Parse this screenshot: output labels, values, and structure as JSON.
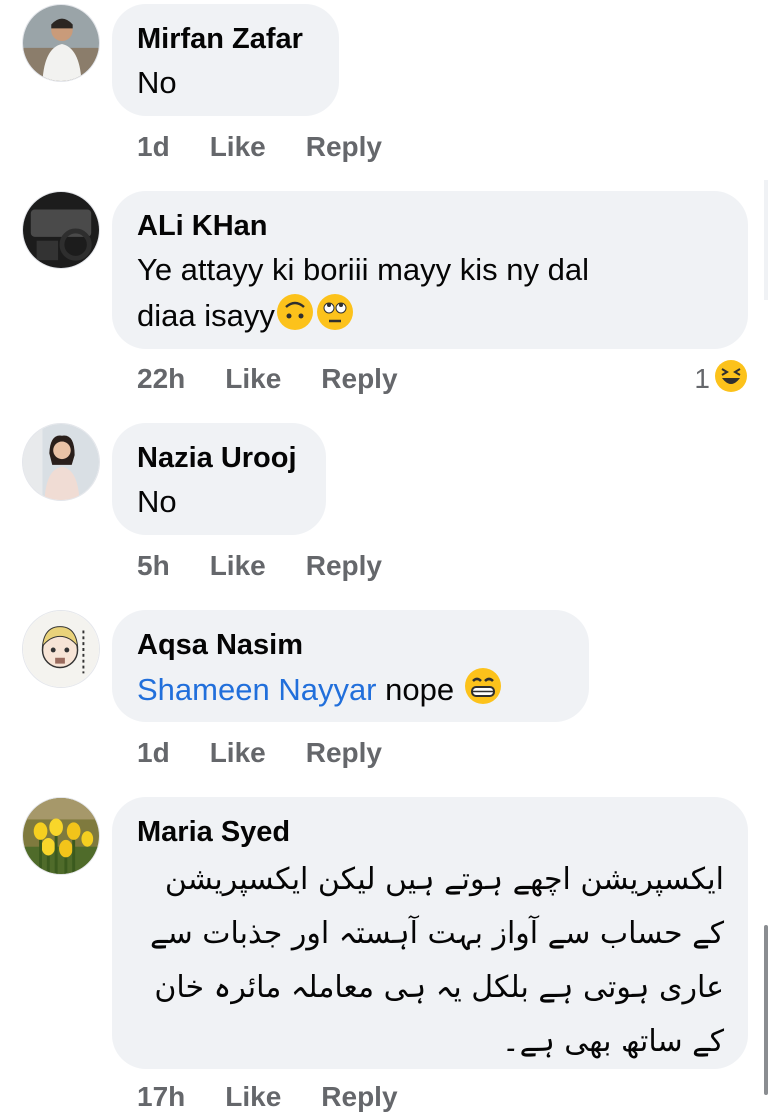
{
  "comments": [
    {
      "author": "Mirfan Zafar",
      "text": "No",
      "time": "1d",
      "like_label": "Like",
      "reply_label": "Reply",
      "avatar_icon": "person-avatar"
    },
    {
      "author": "ALi KHan",
      "text_line1": "Ye attayy ki boriii mayy kis ny dal",
      "text_line2": "diaa isayy",
      "emojis": [
        "upside-down-face-emoji",
        "eye-roll-emoji"
      ],
      "time": "22h",
      "like_label": "Like",
      "reply_label": "Reply",
      "reaction_count": "1",
      "reaction_icon": "laughing-squint-emoji",
      "avatar_icon": "car-interior-avatar"
    },
    {
      "author": "Nazia Urooj",
      "text": "No",
      "time": "5h",
      "like_label": "Like",
      "reply_label": "Reply",
      "avatar_icon": "woman-avatar"
    },
    {
      "author": "Aqsa Nasim",
      "mention": "Shameen Nayyar",
      "text": "nope",
      "emoji": "grinning-face-emoji",
      "time": "1d",
      "like_label": "Like",
      "reply_label": "Reply",
      "avatar_icon": "cartoon-girl-avatar"
    },
    {
      "author": "Maria Syed",
      "urdu_lines": [
        "ایکسپریشن اچھے ہوتے ہیں لیکن ایکسپریشن",
        "کے حساب سے آواز بہت آہستہ اور جذبات سے",
        "عاری ہوتی ہے بلکل یہ ہی معاملہ مائرہ خان",
        "کے ساتھ بھی ہے۔"
      ],
      "time": "17h",
      "like_label": "Like",
      "reply_label": "Reply",
      "avatar_icon": "tulips-avatar"
    }
  ],
  "colors": {
    "bubble": "#f0f2f5",
    "meta": "#65676b",
    "mention": "#216fdb",
    "emoji_yellow": "#fcc21b"
  }
}
